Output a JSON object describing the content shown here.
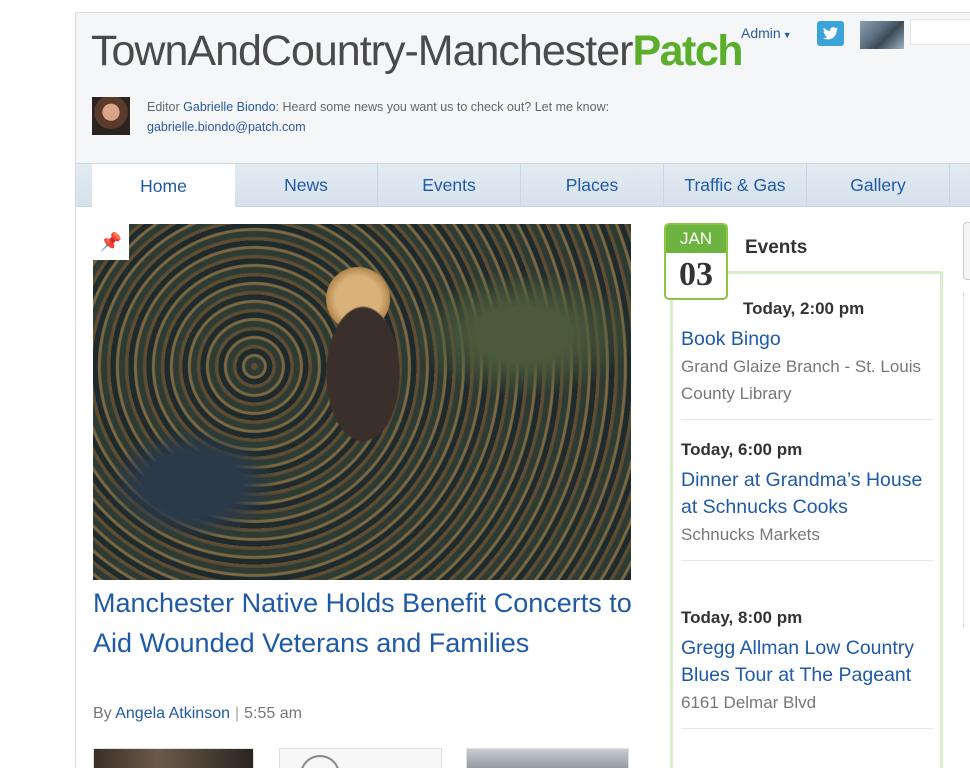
{
  "header": {
    "site_title_main": "TownAndCountry-Manchester",
    "site_title_brand": "Patch",
    "admin_label": "Admin",
    "editor_prefix": "Editor",
    "editor_name": "Gabrielle Biondo",
    "editor_message": ": Heard some news you want us to check out? Let me know:",
    "editor_email": "gabrielle.biondo@patch.com"
  },
  "nav": {
    "tabs": [
      {
        "label": "Home"
      },
      {
        "label": "News"
      },
      {
        "label": "Events"
      },
      {
        "label": "Places"
      },
      {
        "label": "Traffic & Gas"
      },
      {
        "label": "Gallery"
      }
    ]
  },
  "featured": {
    "headline": "Manchester Native Holds Benefit Concerts to Aid Wounded Veterans and Families",
    "by_label": "By",
    "author": "Angela Atkinson",
    "time": "5:55 am"
  },
  "events": {
    "month": "JAN",
    "day": "03",
    "title": "Events",
    "items": [
      {
        "time": "Today,  2:00 pm",
        "title": "Book Bingo",
        "venue": "Grand Glaize Branch - St. Louis County Library"
      },
      {
        "time": "Today,  6:00 pm",
        "title": "Dinner at Grandma’s House at Schnucks Cooks",
        "venue": "Schnucks Markets"
      },
      {
        "time": "Today,  8:00 pm",
        "title": "Gregg Allman Low Country Blues Tour at The Pageant",
        "venue": "6161 Delmar Blvd"
      }
    ]
  },
  "colors": {
    "link_blue": "#1f5aa6",
    "patch_green": "#5aae2a",
    "badge_green": "#6cb33f"
  },
  "icons": {
    "pin": "pin-icon",
    "twitter": "twitter-icon",
    "caret": "chevron-down-icon"
  }
}
